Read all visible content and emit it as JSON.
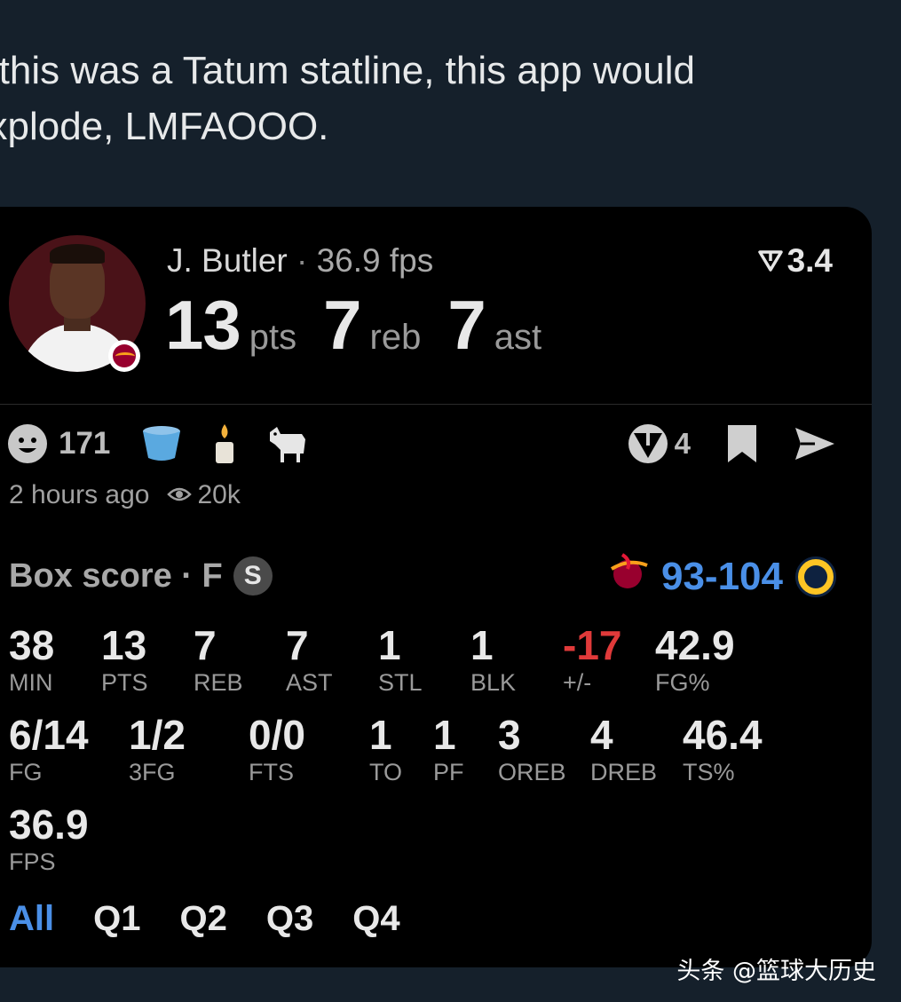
{
  "tweet": {
    "text": "If this was a Tatum statline, this app would\nexplode, LMFAOOO."
  },
  "card": {
    "player": {
      "name": "J. Butler",
      "separator": "·",
      "fps": "36.9 fps",
      "rating": "3.4"
    },
    "headline": [
      {
        "value": "13",
        "unit": "pts"
      },
      {
        "value": "7",
        "unit": "reb"
      },
      {
        "value": "7",
        "unit": "ast"
      }
    ],
    "reactions": {
      "smile_count": "171",
      "icons": [
        "smile-icon",
        "bucket-icon",
        "candle-icon",
        "goat-icon"
      ]
    },
    "actions": {
      "rating_count": "4",
      "icons": [
        "pie-icon",
        "bookmark-icon",
        "send-icon"
      ]
    },
    "meta": {
      "time": "2 hours ago",
      "views": "20k"
    },
    "box": {
      "title": "Box score · F",
      "badge": "S",
      "score": "93-104"
    },
    "stats": {
      "row1": [
        {
          "value": "38",
          "label": "MIN"
        },
        {
          "value": "13",
          "label": "PTS"
        },
        {
          "value": "7",
          "label": "REB"
        },
        {
          "value": "7",
          "label": "AST"
        },
        {
          "value": "1",
          "label": "STL"
        },
        {
          "value": "1",
          "label": "BLK"
        },
        {
          "value": "-17",
          "label": "+/-"
        },
        {
          "value": "42.9",
          "label": "FG%"
        }
      ],
      "row2": [
        {
          "value": "6/14",
          "label": "FG"
        },
        {
          "value": "1/2",
          "label": "3FG"
        },
        {
          "value": "0/0",
          "label": "FTS"
        },
        {
          "value": "1",
          "label": "TO"
        },
        {
          "value": "1",
          "label": "PF"
        },
        {
          "value": "3",
          "label": "OREB"
        },
        {
          "value": "4",
          "label": "DREB"
        },
        {
          "value": "46.4",
          "label": "TS%"
        }
      ],
      "row3": [
        {
          "value": "36.9",
          "label": "FPS"
        }
      ]
    },
    "tabs": [
      "All",
      "Q1",
      "Q2",
      "Q3",
      "Q4"
    ],
    "colors": {
      "accent": "#4a8fe7",
      "negative": "#e03a3a",
      "heat": "#98002e",
      "nuggets": "#fec524"
    }
  },
  "watermark": "头条 @篮球大历史"
}
